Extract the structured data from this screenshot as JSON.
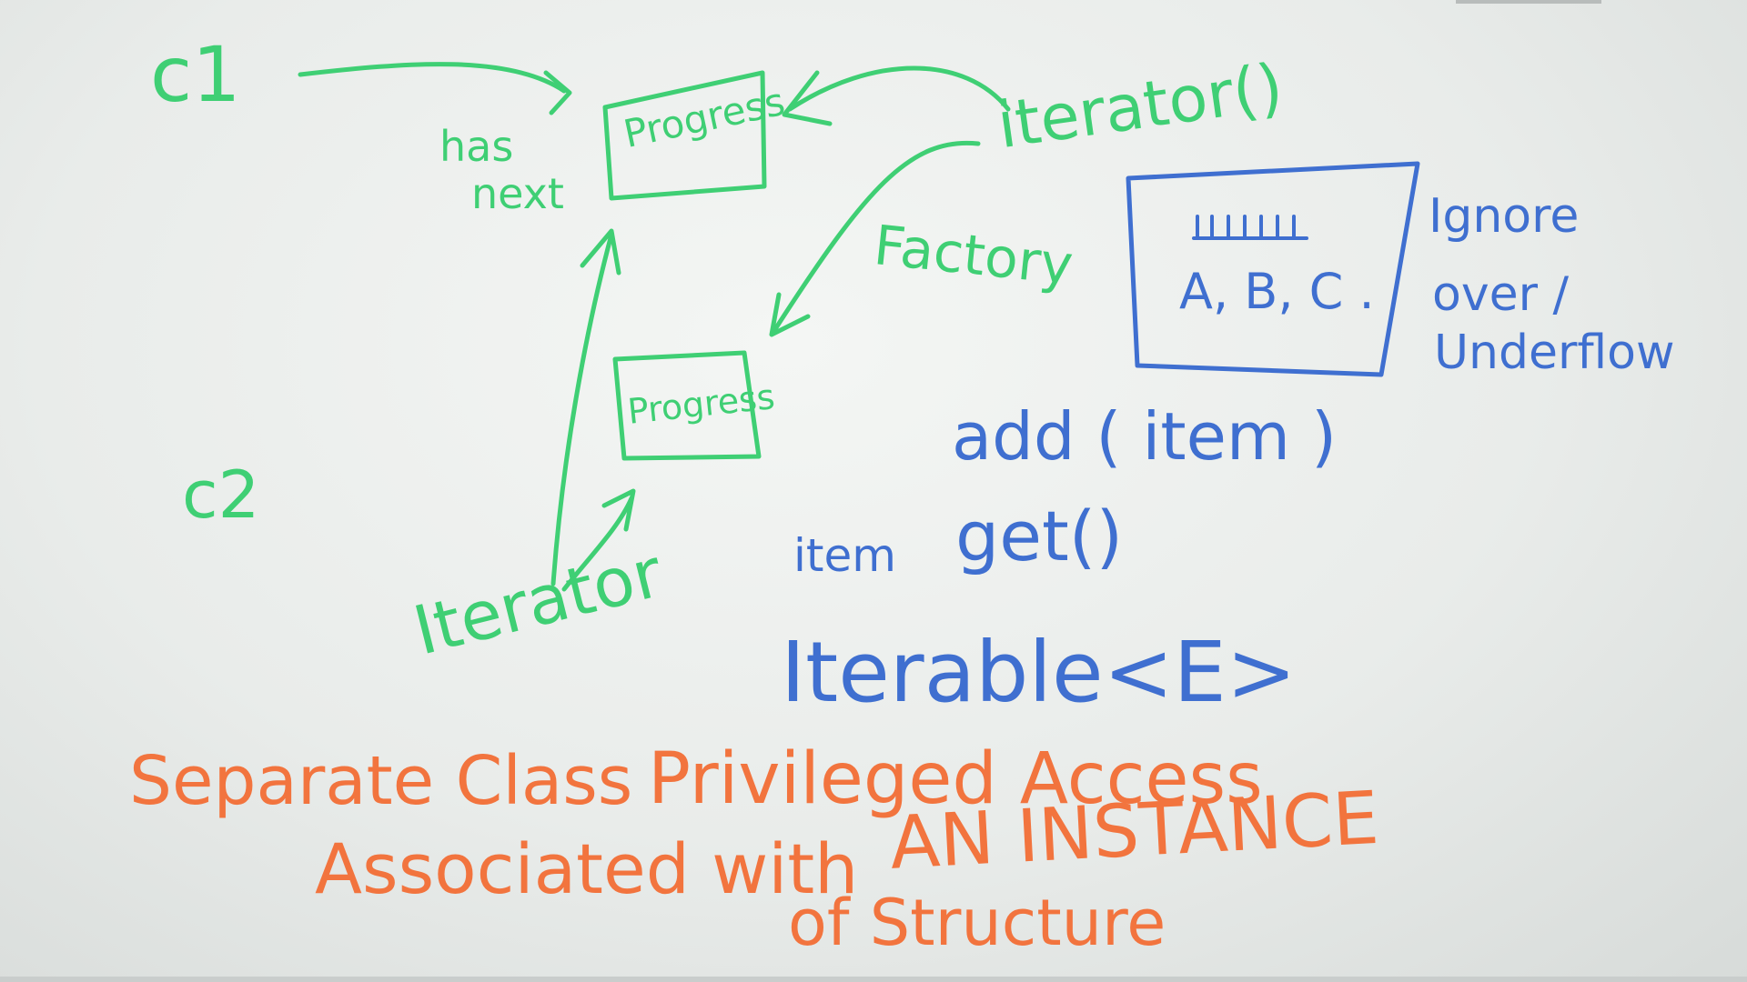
{
  "board": {
    "green": {
      "c1": "c1",
      "c2": "c2",
      "has": "has",
      "next": "next",
      "progress_top": "Progress",
      "progress_bottom": "Progress",
      "iterator_method": "iterator()",
      "factory": "Factory",
      "iterator_word": "Iterator"
    },
    "blue": {
      "array_contents": "A, B, C .",
      "ignore": "Ignore",
      "over": "over /",
      "underflow": "Underflow",
      "add_item": "add ( item )",
      "item": "item",
      "get": "get()",
      "iterable": "Iterable<E>"
    },
    "orange": {
      "separate_class": "Separate Class",
      "privileged_access": "Privileged Access",
      "associated_with": "Associated with",
      "an_instance": "AN INSTANCE",
      "of_structure": "of Structure"
    },
    "colors": {
      "green": "#3fcf74",
      "blue": "#3f6fd0",
      "orange": "#f2743e"
    }
  }
}
